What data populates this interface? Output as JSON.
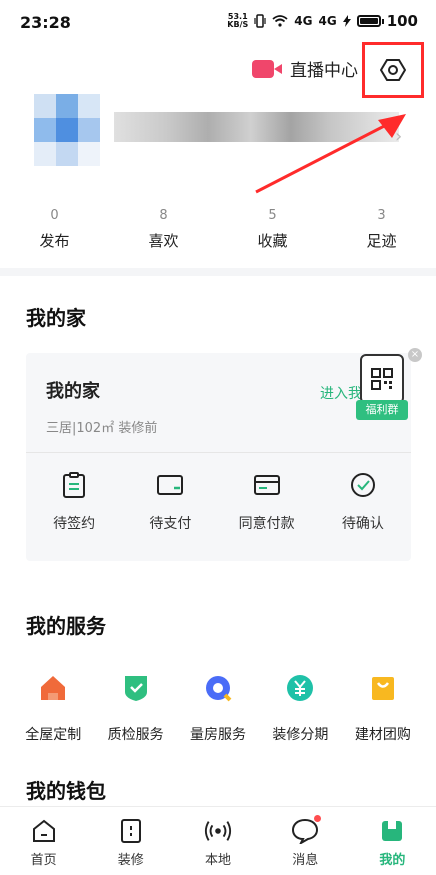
{
  "status_bar": {
    "time": "23:28",
    "net_speed": "53.1",
    "net_unit": "KB/S",
    "signal_1": "4G",
    "signal_2": "4G",
    "battery": "100"
  },
  "header": {
    "live_center_label": "直播中心"
  },
  "stats": [
    {
      "value": "0",
      "label": "发布"
    },
    {
      "value": "8",
      "label": "喜欢"
    },
    {
      "value": "5",
      "label": "收藏"
    },
    {
      "value": "3",
      "label": "足迹"
    }
  ],
  "my_home": {
    "section_title": "我的家",
    "card_title": "我的家",
    "detail": "三居|102㎡  装修前",
    "enter_link": "进入我",
    "welfare_tag": "福利群",
    "actions": [
      {
        "label": "待签约",
        "icon": "clipboard-icon"
      },
      {
        "label": "待支付",
        "icon": "wallet-icon"
      },
      {
        "label": "同意付款",
        "icon": "card-icon"
      },
      {
        "label": "待确认",
        "icon": "check-circle-icon"
      }
    ]
  },
  "services": {
    "section_title": "我的服务",
    "items": [
      {
        "label": "全屋定制",
        "icon": "house-icon",
        "color": "#f06a3a"
      },
      {
        "label": "质检服务",
        "icon": "shield-check-icon",
        "color": "#2fbf80"
      },
      {
        "label": "量房服务",
        "icon": "measure-icon",
        "color": "#4a6cf7"
      },
      {
        "label": "装修分期",
        "icon": "yuan-icon",
        "color": "#1fc1a8"
      },
      {
        "label": "建材团购",
        "icon": "bag-icon",
        "color": "#f8b820"
      }
    ]
  },
  "wallet": {
    "section_title": "我的钱包"
  },
  "tabbar": [
    {
      "label": "首页",
      "icon": "home-icon"
    },
    {
      "label": "装修",
      "icon": "renovate-icon"
    },
    {
      "label": "本地",
      "icon": "broadcast-icon"
    },
    {
      "label": "消息",
      "icon": "chat-icon"
    },
    {
      "label": "我的",
      "icon": "profile-icon"
    }
  ],
  "colors": {
    "accent": "#27b67c",
    "highlight": "#ff2b2b",
    "live": "#f0466b"
  }
}
